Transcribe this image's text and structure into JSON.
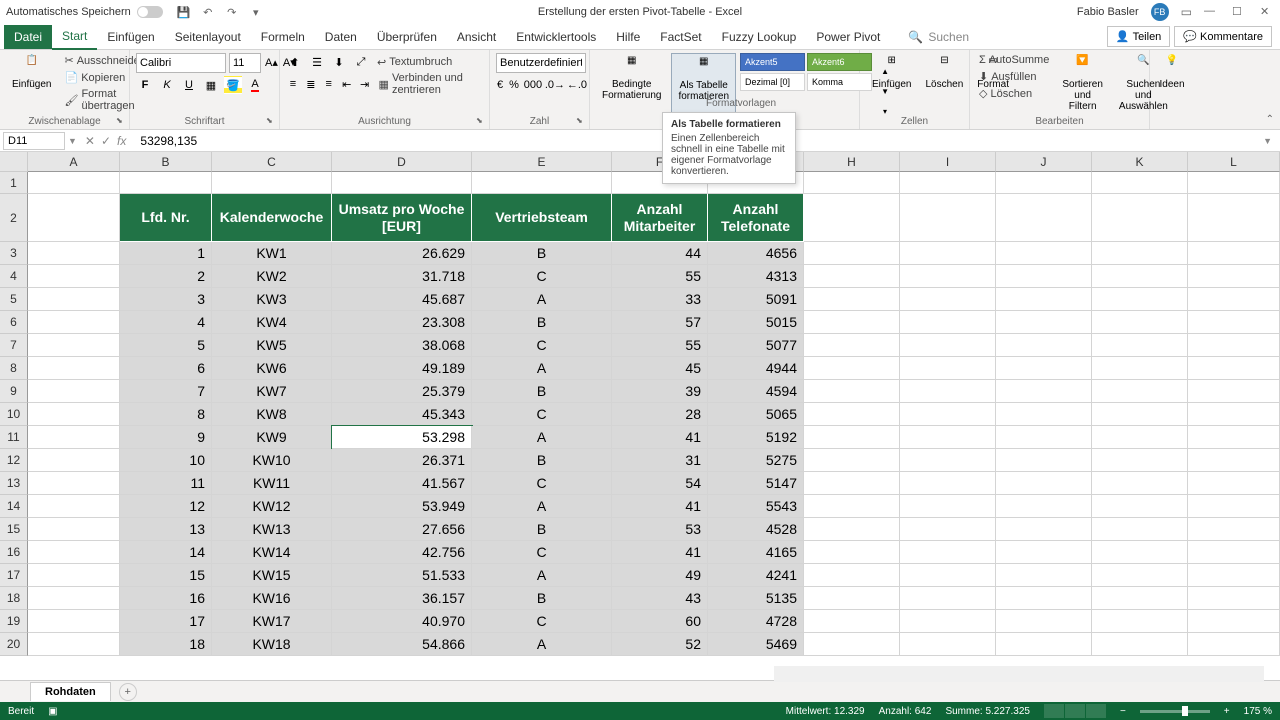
{
  "titlebar": {
    "autosave_label": "Automatisches Speichern",
    "doc_title": "Erstellung der ersten Pivot-Tabelle - Excel",
    "user_name": "Fabio Basler",
    "user_initials": "FB"
  },
  "tabs": {
    "file": "Datei",
    "start": "Start",
    "insert": "Einfügen",
    "pagelayout": "Seitenlayout",
    "formulas": "Formeln",
    "data": "Daten",
    "review": "Überprüfen",
    "view": "Ansicht",
    "developer": "Entwicklertools",
    "help": "Hilfe",
    "factset": "FactSet",
    "fuzzy": "Fuzzy Lookup",
    "pivot": "Power Pivot",
    "search_placeholder": "Suchen",
    "share": "Teilen",
    "comments": "Kommentare"
  },
  "ribbon": {
    "paste": "Einfügen",
    "cut": "Ausschneiden",
    "copy": "Kopieren",
    "fmtpainter": "Format übertragen",
    "clipboard_label": "Zwischenablage",
    "font_name": "Calibri",
    "font_size": "11",
    "font_label": "Schriftart",
    "wrap": "Textumbruch",
    "merge": "Verbinden und zentrieren",
    "align_label": "Ausrichtung",
    "numfmt": "Benutzerdefiniert",
    "number_label": "Zahl",
    "condfmt": "Bedingte Formatierung",
    "astable": "Als Tabelle formatieren",
    "akzent5": "Akzent5",
    "akzent6": "Akzent6",
    "dezimal": "Dezimal [0]",
    "komma": "Komma",
    "styles_label": "Formatvorlagen",
    "insert_cell": "Einfügen",
    "delete_cell": "Löschen",
    "format_cell": "Format",
    "cells_label": "Zellen",
    "autosum": "AutoSumme",
    "fill": "Ausfüllen",
    "clear": "Löschen",
    "sortfilter": "Sortieren und Filtern",
    "findselect": "Suchen und Auswählen",
    "edit_label": "Bearbeiten",
    "ideas": "Ideen"
  },
  "tooltip": {
    "title": "Als Tabelle formatieren",
    "body": "Einen Zellenbereich schnell in eine Tabelle mit eigener Formatvorlage konvertieren.",
    "extra": "Formatvorlagen"
  },
  "formula": {
    "cell_ref": "D11",
    "value": "53298,135"
  },
  "columns": [
    "A",
    "B",
    "C",
    "D",
    "E",
    "F",
    "G",
    "H",
    "I",
    "J",
    "K",
    "L"
  ],
  "table": {
    "headers": {
      "lfd": "Lfd. Nr.",
      "kw": "Kalenderwoche",
      "umsatz": "Umsatz pro Woche [EUR]",
      "team": "Vertriebsteam",
      "mitarbeiter": "Anzahl Mitarbeiter",
      "telefonate": "Anzahl Telefonate"
    },
    "rows": [
      {
        "n": "1",
        "kw": "KW1",
        "u": "26.629",
        "t": "B",
        "m": "44",
        "tel": "4656"
      },
      {
        "n": "2",
        "kw": "KW2",
        "u": "31.718",
        "t": "C",
        "m": "55",
        "tel": "4313"
      },
      {
        "n": "3",
        "kw": "KW3",
        "u": "45.687",
        "t": "A",
        "m": "33",
        "tel": "5091"
      },
      {
        "n": "4",
        "kw": "KW4",
        "u": "23.308",
        "t": "B",
        "m": "57",
        "tel": "5015"
      },
      {
        "n": "5",
        "kw": "KW5",
        "u": "38.068",
        "t": "C",
        "m": "55",
        "tel": "5077"
      },
      {
        "n": "6",
        "kw": "KW6",
        "u": "49.189",
        "t": "A",
        "m": "45",
        "tel": "4944"
      },
      {
        "n": "7",
        "kw": "KW7",
        "u": "25.379",
        "t": "B",
        "m": "39",
        "tel": "4594"
      },
      {
        "n": "8",
        "kw": "KW8",
        "u": "45.343",
        "t": "C",
        "m": "28",
        "tel": "5065"
      },
      {
        "n": "9",
        "kw": "KW9",
        "u": "53.298",
        "t": "A",
        "m": "41",
        "tel": "5192"
      },
      {
        "n": "10",
        "kw": "KW10",
        "u": "26.371",
        "t": "B",
        "m": "31",
        "tel": "5275"
      },
      {
        "n": "11",
        "kw": "KW11",
        "u": "41.567",
        "t": "C",
        "m": "54",
        "tel": "5147"
      },
      {
        "n": "12",
        "kw": "KW12",
        "u": "53.949",
        "t": "A",
        "m": "41",
        "tel": "5543"
      },
      {
        "n": "13",
        "kw": "KW13",
        "u": "27.656",
        "t": "B",
        "m": "53",
        "tel": "4528"
      },
      {
        "n": "14",
        "kw": "KW14",
        "u": "42.756",
        "t": "C",
        "m": "41",
        "tel": "4165"
      },
      {
        "n": "15",
        "kw": "KW15",
        "u": "51.533",
        "t": "A",
        "m": "49",
        "tel": "4241"
      },
      {
        "n": "16",
        "kw": "KW16",
        "u": "36.157",
        "t": "B",
        "m": "43",
        "tel": "5135"
      },
      {
        "n": "17",
        "kw": "KW17",
        "u": "40.970",
        "t": "C",
        "m": "60",
        "tel": "4728"
      },
      {
        "n": "18",
        "kw": "KW18",
        "u": "54.866",
        "t": "A",
        "m": "52",
        "tel": "5469"
      }
    ]
  },
  "sheets": {
    "s1": "Rohdaten"
  },
  "status": {
    "ready": "Bereit",
    "avg_label": "Mittelwert:",
    "avg": "12.329",
    "count_label": "Anzahl:",
    "count": "642",
    "sum_label": "Summe:",
    "sum": "5.227.325",
    "zoom": "175 %"
  }
}
